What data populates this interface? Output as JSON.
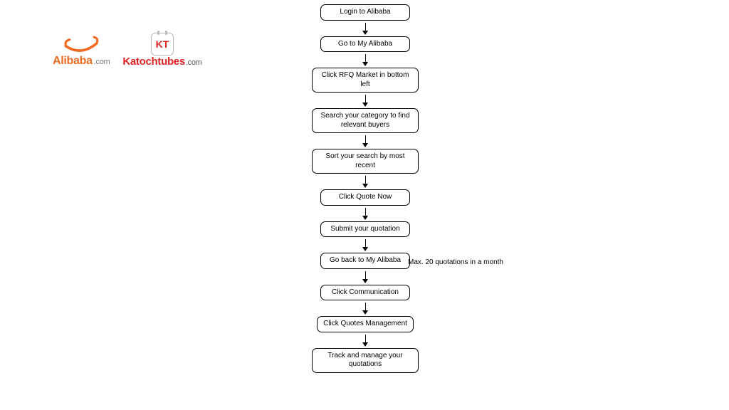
{
  "logos": {
    "alibaba": {
      "name": "Alibaba",
      "suffix": ".com",
      "icon": "alibaba-smile-icon"
    },
    "katoch": {
      "name": "Katochtubes",
      "suffix": ".com",
      "icon": "kt-badge-icon",
      "badge": "KT"
    }
  },
  "flow": {
    "steps": [
      {
        "label": "Login to Alibaba"
      },
      {
        "label": "Go to My Alibaba"
      },
      {
        "label": "Click RFQ Market in bottom left"
      },
      {
        "label": "Search your category to find relevant buyers"
      },
      {
        "label": "Sort your search by most recent"
      },
      {
        "label": "Click Quote Now"
      },
      {
        "label": "Submit your quotation"
      },
      {
        "label": "Go back to My Alibaba"
      },
      {
        "label": "Click Communication"
      },
      {
        "label": "Click Quotes Management"
      },
      {
        "label": "Track and manage your quotations"
      }
    ]
  },
  "annotation": {
    "text": "Max. 20 quotations in a month"
  }
}
